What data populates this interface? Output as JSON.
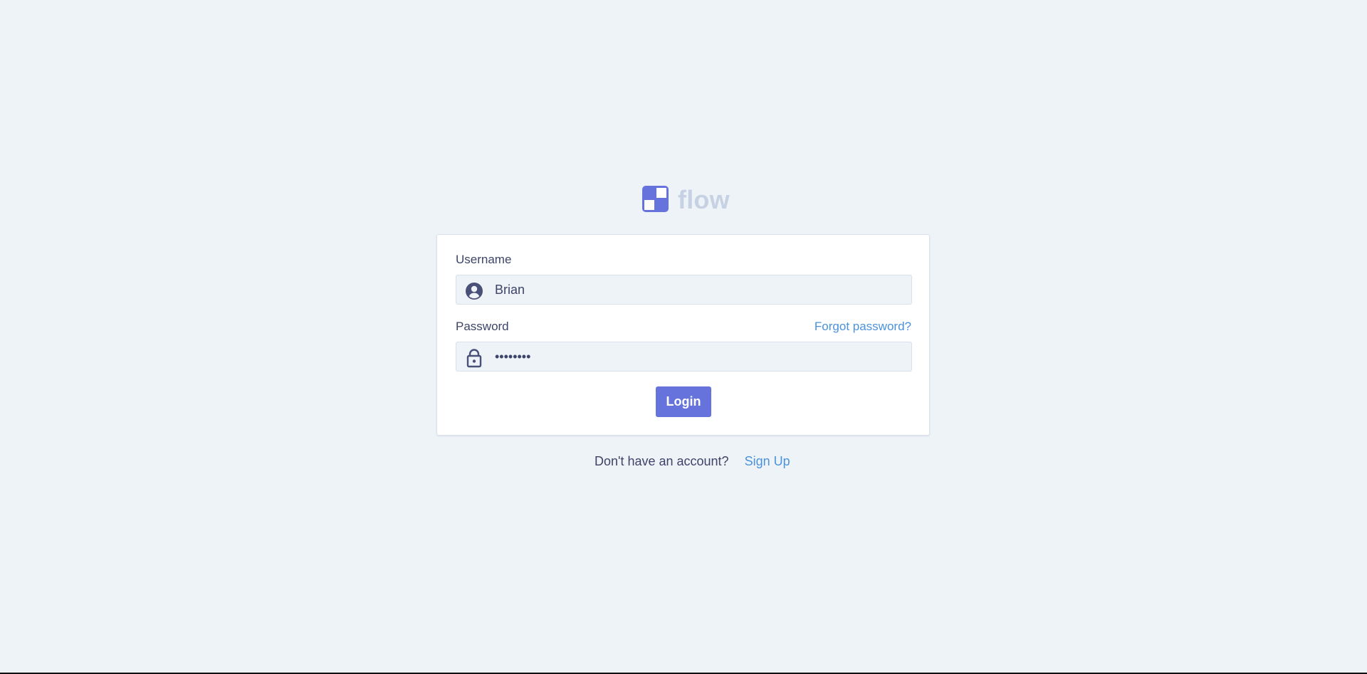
{
  "app": {
    "name": "flow",
    "accent": "#6673dd",
    "brand_muted": "#c6d2e3",
    "background": "#eef3f8",
    "link_color": "#4b92dd"
  },
  "form": {
    "username_label": "Username",
    "username_value": "Brian",
    "username_icon": "user-circle-icon",
    "password_label": "Password",
    "forgot_password": "Forgot password?",
    "password_value": "••••••••",
    "password_icon": "lock-icon",
    "login_label": "Login"
  },
  "footer": {
    "prompt": "Don't have an account?",
    "signup_label": "Sign Up"
  }
}
